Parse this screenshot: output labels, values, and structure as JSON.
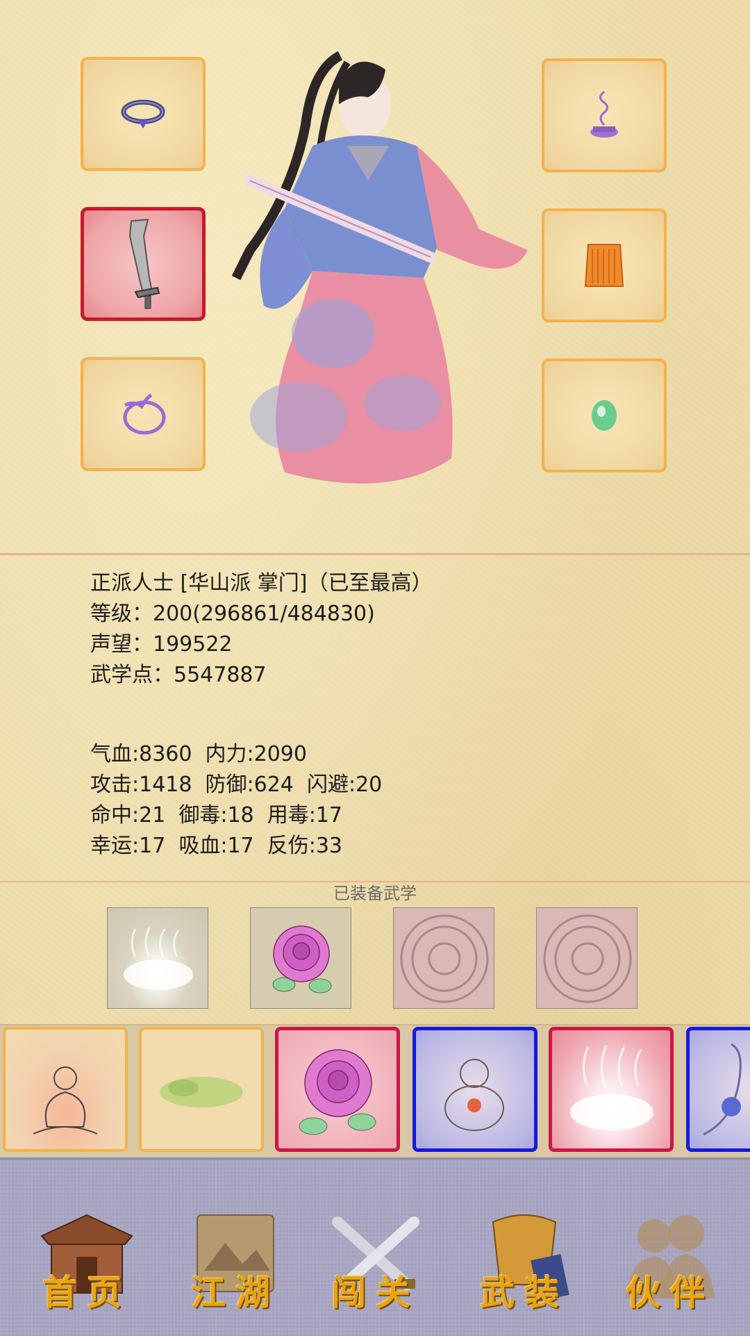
{
  "equipment": {
    "left": [
      {
        "icon": "ring-icon",
        "rarity": "normal"
      },
      {
        "icon": "sword-icon",
        "rarity": "rare"
      },
      {
        "icon": "bracelet-icon",
        "rarity": "normal"
      }
    ],
    "right": [
      {
        "icon": "incense-icon",
        "rarity": "normal"
      },
      {
        "icon": "robe-icon",
        "rarity": "normal"
      },
      {
        "icon": "jade-icon",
        "rarity": "normal"
      }
    ]
  },
  "character": {
    "title_line": "正派人士 [华山派 掌门]（已至最高）",
    "level_line": "等级：200(296861/484830)",
    "reputation_line": "声望：199522",
    "points_line": "武学点：5547887"
  },
  "stats": {
    "line1": "气血:8360  内力:2090",
    "line2": "攻击:1418  防御:624  闪避:20",
    "line3": "命中:21  御毒:18  用毒:17",
    "line4": "幸运:17  吸血:17  反伤:33"
  },
  "equipped_skills_label": "已装备武学",
  "equipped_skills": [
    "steam-icon",
    "rose-icon",
    "seal-icon",
    "seal-icon"
  ],
  "skill_list": [
    "meditation-icon",
    "herb-icon",
    "rose-icon",
    "gourd-icon",
    "steam-icon",
    "hand-icon"
  ],
  "nav": {
    "home": "首页",
    "jianghu": "江湖",
    "challenge": "闯关",
    "equip": "武装",
    "partner": "伙伴"
  },
  "colors": {
    "slot_border": "#f3b24e",
    "rare_border": "#c8182b",
    "epic_border": "#1418e0",
    "nav_text": "#e7a514"
  }
}
